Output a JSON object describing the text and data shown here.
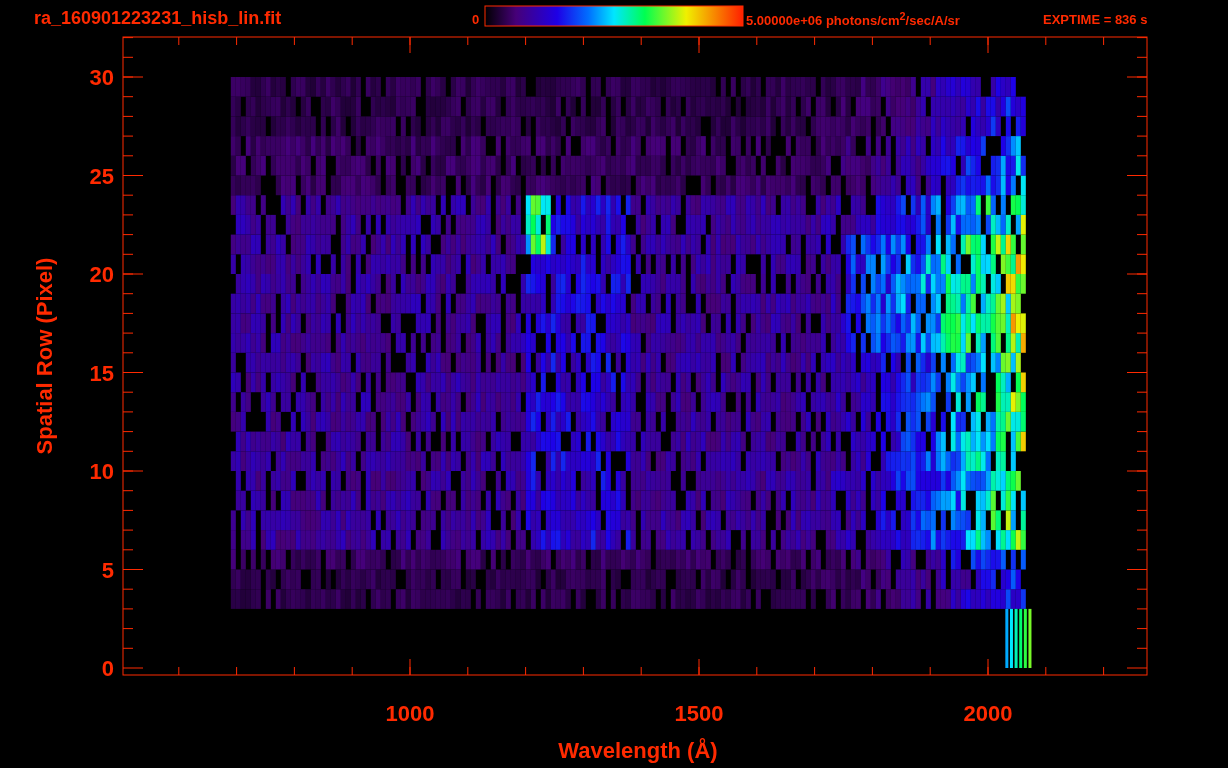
{
  "header": {
    "file_name": "ra_160901223231_hisb_lin.fit",
    "colorbar_min": "0",
    "colorbar_max": "5.00000e+06 photons/cm$^{2}$/sec/A/sr",
    "exposure": "EXPTIME = 836 s"
  },
  "plot": {
    "y_label": "Spatial Row (Pixel)",
    "x_label": "Wavelength (Å)",
    "y_ticks": [
      "30",
      "25",
      "20",
      "15",
      "10",
      "5",
      "0"
    ],
    "x_ticks": [
      "1000",
      "1500",
      "2000"
    ]
  }
}
